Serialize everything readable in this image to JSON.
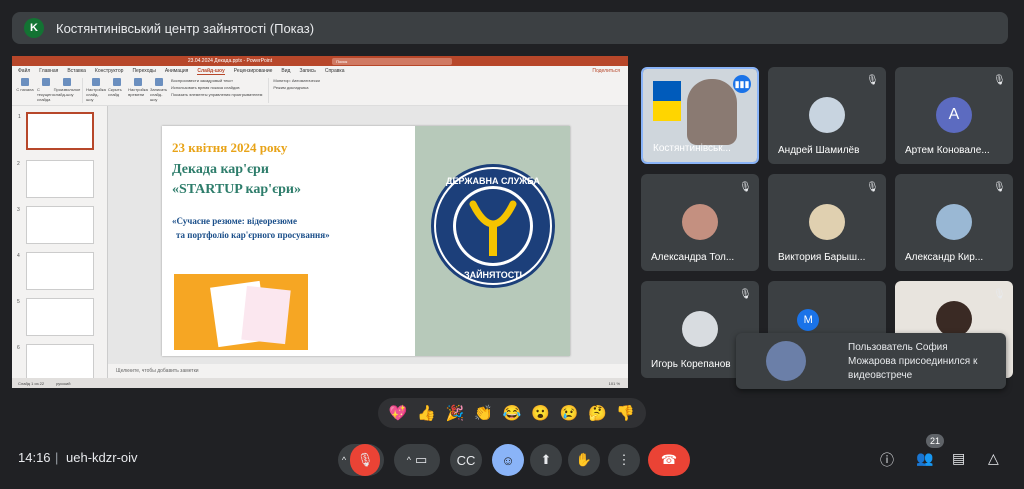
{
  "meeting": {
    "presenter_initial": "K",
    "presenter_title": "Костянтинівський центр зайнятості (Показ)",
    "time": "14:16",
    "separator": "|",
    "code": "ueh-kdzr-oiv",
    "participant_count": "21"
  },
  "ppt": {
    "filename": "23.04.2024 Декада.pptx - PowerPoint",
    "search_placeholder": "Поиск",
    "menus": [
      "Файл",
      "Главная",
      "Вставка",
      "Конструктор",
      "Переходы",
      "Анимация",
      "Слайд-шоу",
      "Рецензирование",
      "Вид",
      "Запись",
      "Справка"
    ],
    "active_menu": "Слайд-шоу",
    "share": "Поделиться",
    "ribbon": {
      "from_start": "С начала",
      "from_current": "С текущего слайда",
      "custom": "Произвольное слайд-шоу",
      "setup": "Настройка слайд-шоу",
      "hide": "Скрыть слайд",
      "rehearse": "Настройка времени",
      "record": "Записать слайд-шоу",
      "check1": "Воспроизвести закадровый текст",
      "check2": "Использовать время показа слайдов",
      "check3": "Показать элементы управления проигрывателем",
      "monitor": "Монитор: Автоматически",
      "presenter_view": "Режим докладчика"
    },
    "notes": "Щелкните, чтобы добавить заметки",
    "status_slide": "Слайд 1 из 22",
    "status_lang": "русский",
    "status_notes": "Заметки",
    "status_comments": "Примечания",
    "status_zoom": "101 %",
    "slide": {
      "date": "23 квітня 2024 року",
      "heading1": "Декада кар'єри",
      "heading2": "«STARTUP кар'єри»",
      "subtitle1": "«Сучасне резюме: відеорезюме",
      "subtitle2": "та портфоліо кар'єрного просування»",
      "logo_text_top": "ДЕРЖАВНА СЛУЖБА",
      "logo_text_bottom": "ЗАЙНЯТОСТІ"
    }
  },
  "participants": [
    {
      "name": "Костянтинівськ...",
      "speaking": true
    },
    {
      "name": "Андрей Шамилёв"
    },
    {
      "name": "Артем Коновале...",
      "initial": "A"
    },
    {
      "name": "Александра Тол..."
    },
    {
      "name": "Виктория Барыш..."
    },
    {
      "name": "Александр Кир..."
    },
    {
      "name": "Игорь Корепанов"
    },
    {
      "name": "",
      "initial": "M"
    },
    {
      "name": ""
    }
  ],
  "toast": {
    "text": "Пользователь София Можарова присоединился к видеовстрече"
  },
  "reactions": [
    "💖",
    "👍",
    "🎉",
    "👏",
    "😂",
    "😮",
    "😢",
    "🤔",
    "👎"
  ],
  "colors": {
    "background": "#202124",
    "tile": "#3c4043",
    "end_call": "#ea4335",
    "accent": "#8ab4f8",
    "ppt_brand": "#b7472a"
  }
}
